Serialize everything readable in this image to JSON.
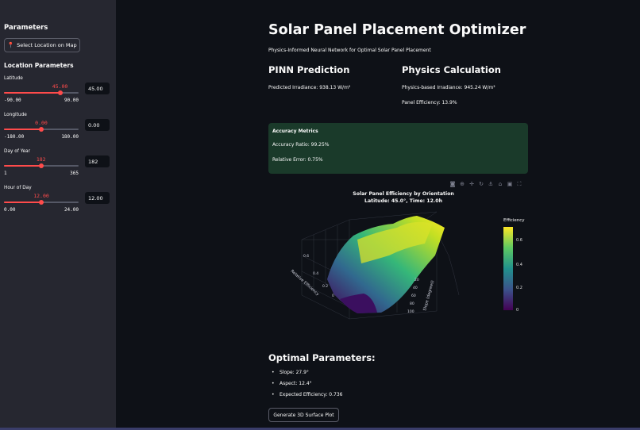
{
  "sidebar": {
    "title": "Parameters",
    "map_button": "Select Location on Map",
    "location_title": "Location Parameters",
    "sliders": [
      {
        "label": "Latitude",
        "value": "45.00",
        "min": "-90.00",
        "max": "90.00",
        "input": "45.00",
        "fraction": 0.75
      },
      {
        "label": "Longitude",
        "value": "0.00",
        "min": "-180.00",
        "max": "180.00",
        "input": "0.00",
        "fraction": 0.5
      },
      {
        "label": "Day of Year",
        "value": "182",
        "min": "1",
        "max": "365",
        "input": "182",
        "fraction": 0.497
      },
      {
        "label": "Hour of Day",
        "value": "12.00",
        "min": "0.00",
        "max": "24.00",
        "input": "12.00",
        "fraction": 0.5
      }
    ]
  },
  "main": {
    "title": "Solar Panel Placement Optimizer",
    "subtitle": "Physics-Informed Neural Network for Optimal Solar Panel Placement",
    "pinn": {
      "heading": "PINN Prediction",
      "irradiance": "Predicted Irradiance: 938.13 W/m²"
    },
    "physics": {
      "heading": "Physics Calculation",
      "irradiance": "Physics-based Irradiance: 945.24 W/m²",
      "efficiency": "Panel Efficiency: 13.9%"
    },
    "accuracy": {
      "title": "Accuracy Metrics",
      "ratio": "Accuracy Ratio: 99.25%",
      "error": "Relative Error: 0.75%"
    },
    "plot": {
      "title_line1": "Solar Panel Efficiency by Orientation",
      "title_line2": "Latitude: 45.0°, Time: 12.0h",
      "z_axis_label": "Relative Efficiency",
      "y_axis_label": "Slope (degrees)",
      "z_ticks": [
        "0.6",
        "0.4",
        "0.2",
        "0"
      ],
      "y_ticks": [
        "20",
        "40",
        "60",
        "80",
        "100"
      ],
      "colorbar_title": "Efficiency",
      "colorbar_ticks": [
        "0.6",
        "0.4",
        "0.2",
        "0"
      ],
      "toolbar_icons": [
        "camera-icon",
        "zoom-icon",
        "pan-icon",
        "rotate-icon",
        "orbit-icon",
        "home-icon",
        "video-icon",
        "fullscreen-icon"
      ]
    },
    "optimal": {
      "title": "Optimal Parameters:",
      "slope": "Slope: 27.9°",
      "aspect": "Aspect: 12.4°",
      "efficiency": "Expected Efficiency: 0.736"
    },
    "generate_button": "Generate 3D Surface Plot"
  }
}
